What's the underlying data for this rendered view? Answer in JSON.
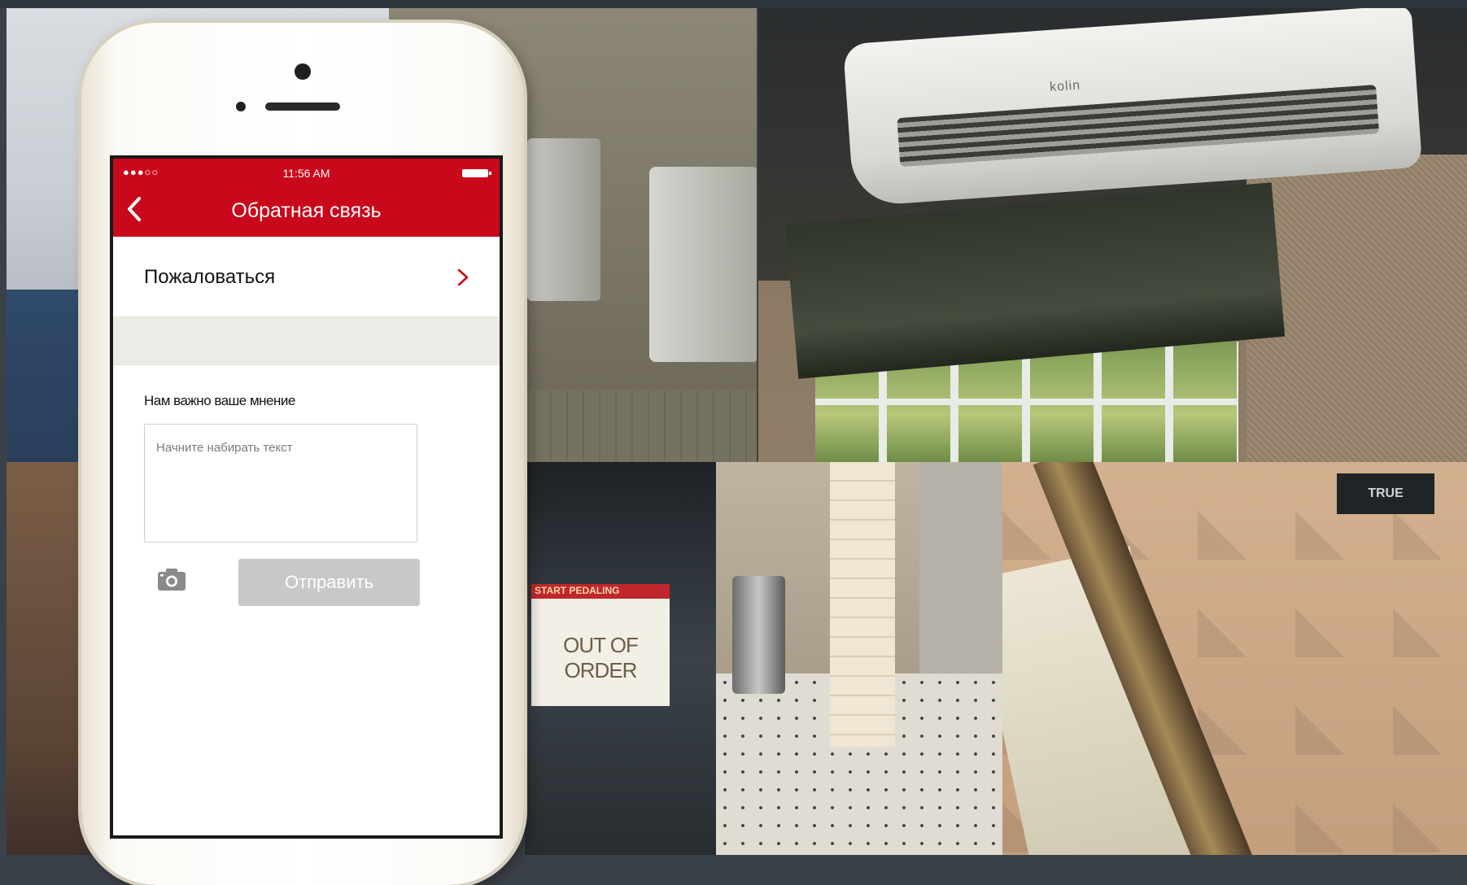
{
  "status_bar": {
    "carrier": "●●●○○",
    "time": "11:56 AM"
  },
  "nav": {
    "title": "Обратная связь",
    "back_icon": "chevron-left-icon"
  },
  "menu": {
    "complain_label": "Пожаловаться",
    "chevron_icon": "chevron-right-icon"
  },
  "feedback": {
    "label": "Нам важно ваше мнение",
    "placeholder": "Начните набирать текст",
    "camera_icon": "camera-icon",
    "send_label": "Отправить"
  },
  "background": {
    "ac_brand": "kolin",
    "treadmill_banner": "START PEDALING",
    "out_of_order": "OUT OF ORDER",
    "gym_brand": "TRUE"
  },
  "colors": {
    "accent": "#c9081b",
    "send_disabled": "#c8c8c8",
    "chevron": "#c9081b"
  }
}
